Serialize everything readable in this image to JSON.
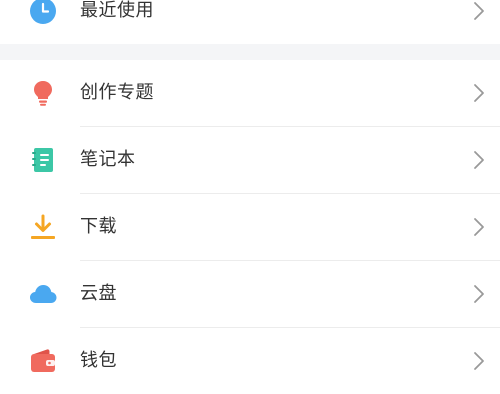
{
  "top_group": {
    "items": [
      {
        "label": "最近使用",
        "icon": "clock-icon",
        "color": "#4aa8f0"
      }
    ]
  },
  "main_group": {
    "items": [
      {
        "label": "创作专题",
        "icon": "lightbulb-icon",
        "color": "#f06a5e"
      },
      {
        "label": "笔记本",
        "icon": "notebook-icon",
        "color": "#3cc7a6"
      },
      {
        "label": "下载",
        "icon": "download-icon",
        "color": "#f5a623"
      },
      {
        "label": "云盘",
        "icon": "cloud-icon",
        "color": "#4aa8f0"
      },
      {
        "label": "钱包",
        "icon": "wallet-icon",
        "color": "#f06a5e"
      }
    ]
  }
}
